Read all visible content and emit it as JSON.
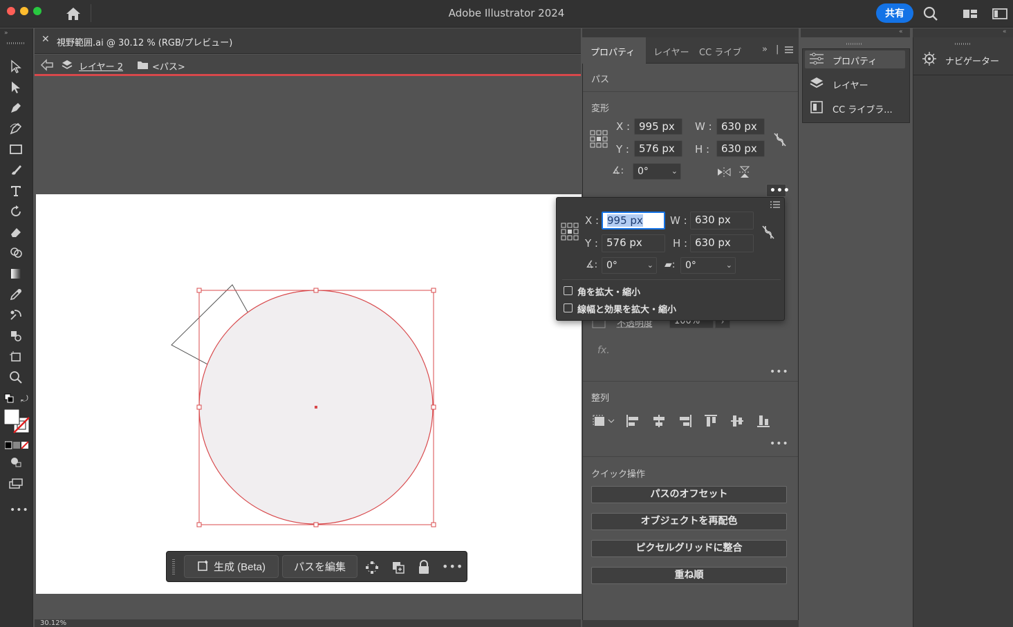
{
  "app": {
    "title": "Adobe Illustrator 2024",
    "share_label": "共有"
  },
  "document": {
    "tab_label": "視野範囲.ai @ 30.12 % (RGB/プレビュー)",
    "breadcrumb": {
      "layer": "レイヤー 2",
      "object": "<パス>"
    }
  },
  "panel": {
    "tabs": [
      "プロパティ",
      "レイヤー",
      "CC ライブ"
    ],
    "object_type": "パス",
    "transform": {
      "title": "変形",
      "x_label": "X :",
      "x": "995 px",
      "y_label": "Y :",
      "y": "576 px",
      "w_label": "W :",
      "w": "630 px",
      "h_label": "H :",
      "h": "630 px",
      "angle": "0°"
    },
    "appearance": {
      "opacity_label": "不透明度",
      "opacity_value": "100%",
      "fx": "fx."
    },
    "align": {
      "title": "整列"
    },
    "quick_actions": {
      "title": "クイック操作",
      "buttons": [
        "パスのオフセット",
        "オブジェクトを再配色",
        "ピクセルグリッドに整合",
        "重ね順"
      ]
    }
  },
  "popup": {
    "x_label": "X :",
    "x": "995 px",
    "y_label": "Y :",
    "y": "576 px",
    "w_label": "W :",
    "w": "630 px",
    "h_label": "H :",
    "h": "630 px",
    "angle": "0°",
    "shear": "0°",
    "scale_corners": "角を拡大・縮小",
    "scale_strokes": "線幅と効果を拡大・縮小"
  },
  "taskbar": {
    "generate": "生成 (Beta)",
    "edit_path": "パスを編集"
  },
  "status": {
    "zoom": "30.12%"
  },
  "dock": {
    "items": [
      "プロパティ",
      "レイヤー",
      "CC ライブラ..."
    ],
    "navigator": "ナビゲーター"
  },
  "colors": {
    "accent": "#1473e6",
    "selection": "#d8484b"
  }
}
